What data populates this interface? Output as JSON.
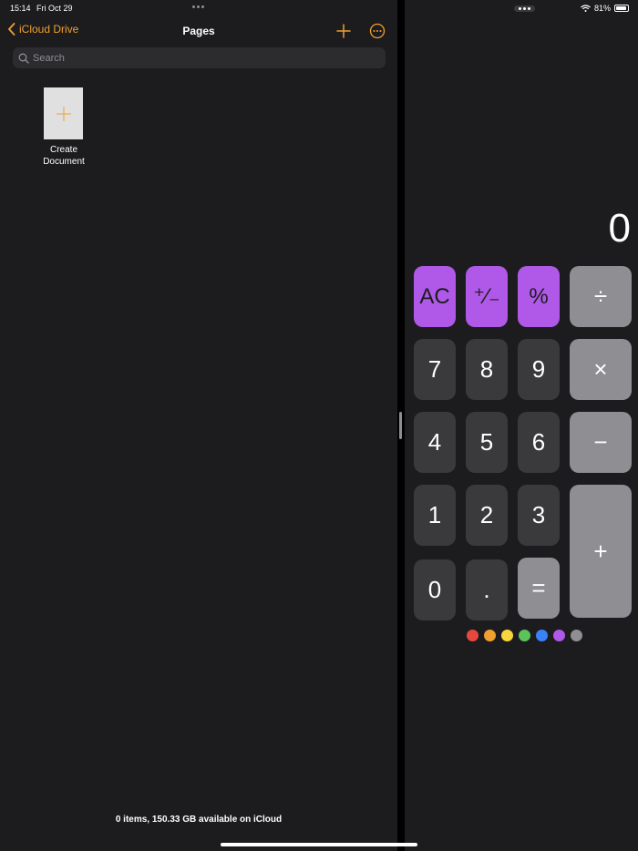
{
  "status_bar": {
    "time": "15:14",
    "date": "Fri Oct 29",
    "battery": "81%",
    "battery_level": 0.81
  },
  "pages": {
    "back_label": "iCloud Drive",
    "title": "Pages",
    "search": {
      "placeholder": "Search",
      "value": ""
    },
    "create_label": "Create\nDocument",
    "footer": "0 items, 150.33 GB available on iCloud",
    "accent": "#f0a030"
  },
  "calculator": {
    "display": "0",
    "keys": {
      "clear": "AC",
      "sign": "⁺∕₋",
      "percent": "%",
      "divide": "÷",
      "seven": "7",
      "eight": "8",
      "nine": "9",
      "multiply": "×",
      "four": "4",
      "five": "5",
      "six": "6",
      "minus": "−",
      "one": "1",
      "two": "2",
      "three": "3",
      "plus": "+",
      "zero": "0",
      "decimal": ".",
      "equals": "="
    },
    "theme_colors": [
      "#e5483f",
      "#f0a030",
      "#f7d53c",
      "#5ac35a",
      "#3a82f7",
      "#b058e8",
      "#8e8e93"
    ],
    "accent": "#b058e8"
  }
}
